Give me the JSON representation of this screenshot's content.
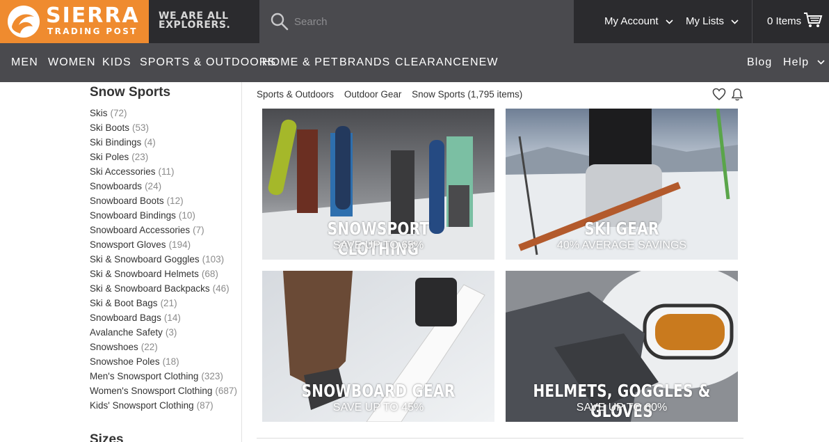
{
  "brand": {
    "name": "SIERRA",
    "sub": "TRADING POST",
    "tagline_line1": "WE ARE ALL",
    "tagline_line2": "EXPLORERS."
  },
  "search": {
    "placeholder": "Search"
  },
  "account": {
    "my_account": "My Account",
    "my_lists": "My Lists",
    "cart": "0 Items"
  },
  "nav": {
    "items": [
      "MEN",
      "WOMEN",
      "KIDS",
      "SPORTS & OUTDOORS",
      "HOME & PET",
      "BRANDS",
      "CLEARANCE",
      "NEW"
    ],
    "blog": "Blog",
    "help": "Help"
  },
  "sidebar": {
    "title": "Snow Sports",
    "items": [
      {
        "label": "Skis",
        "count": "(72)"
      },
      {
        "label": "Ski Boots",
        "count": "(53)"
      },
      {
        "label": "Ski Bindings",
        "count": "(4)"
      },
      {
        "label": "Ski Poles",
        "count": "(23)"
      },
      {
        "label": "Ski Accessories",
        "count": "(11)"
      },
      {
        "label": "Snowboards",
        "count": "(24)"
      },
      {
        "label": "Snowboard Boots",
        "count": "(12)"
      },
      {
        "label": "Snowboard Bindings",
        "count": "(10)"
      },
      {
        "label": "Snowboard Accessories",
        "count": "(7)"
      },
      {
        "label": "Snowsport Gloves",
        "count": "(194)"
      },
      {
        "label": "Ski & Snowboard Goggles",
        "count": "(103)"
      },
      {
        "label": "Ski & Snowboard Helmets",
        "count": "(68)"
      },
      {
        "label": "Ski & Snowboard Backpacks",
        "count": "(46)"
      },
      {
        "label": "Ski & Boot Bags",
        "count": "(21)"
      },
      {
        "label": "Snowboard Bags",
        "count": "(14)"
      },
      {
        "label": "Avalanche Safety",
        "count": "(3)"
      },
      {
        "label": "Snowshoes",
        "count": "(22)"
      },
      {
        "label": "Snowshoe Poles",
        "count": "(18)"
      },
      {
        "label": "Men's Snowsport Clothing",
        "count": "(323)"
      },
      {
        "label": "Women's Snowsport Clothing",
        "count": "(687)"
      },
      {
        "label": "Kids' Snowsport Clothing",
        "count": "(87)"
      }
    ],
    "title2": "Sizes"
  },
  "breadcrumb": {
    "items": [
      "Sports & Outdoors",
      "Outdoor Gear",
      "Snow Sports (1,795 items)"
    ]
  },
  "tiles": [
    {
      "title": "SNOWSPORT CLOTHING",
      "sub": "SAVE UP TO 65%"
    },
    {
      "title": "SKI GEAR",
      "sub": "40% AVERAGE SAVINGS"
    },
    {
      "title": "SNOWBOARD GEAR",
      "sub": "SAVE UP TO 45%"
    },
    {
      "title": "HELMETS, GOGGLES & GLOVES",
      "sub": "SAVE UP TO 60%"
    }
  ],
  "colors": {
    "brand_orange": "#ef8b2f",
    "topbar": "#2b2b2e",
    "nav": "#4a4a4e"
  }
}
